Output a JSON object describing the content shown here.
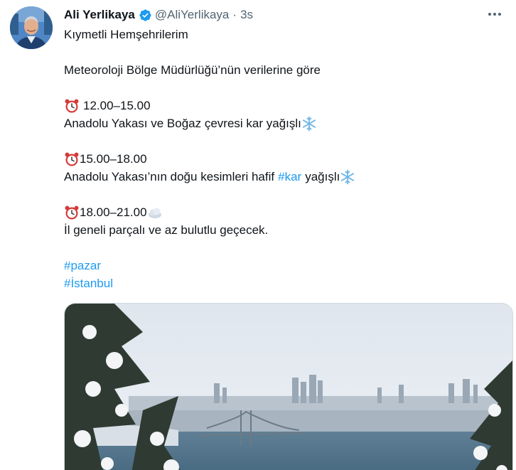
{
  "author": {
    "display_name": "Ali Yerlikaya",
    "handle": "@AliYerlikaya",
    "separator": "·",
    "time": "3s",
    "verified": true
  },
  "tweet": {
    "greeting": "Kıymetli Hemşehrilerim",
    "source": "Meteoroloji Bölge Müdürlüğü’nün verilerine göre",
    "block1": {
      "time": "12.00–15.00",
      "text": "Anadolu Yakası ve Boğaz çevresi kar yağışlı"
    },
    "block2": {
      "time": "15.00–18.00",
      "text_before": "Anadolu Yakası’nın doğu kesimleri hafif",
      "hashtag": "#kar",
      "text_after": "yağışlı"
    },
    "block3": {
      "time": "18.00–21.00",
      "text": "İl geneli parçalı ve az bulutlu geçecek."
    },
    "hashtags": [
      "#pazar",
      "#İstanbul"
    ]
  },
  "icons": {
    "verified": "verified-badge-icon",
    "more": "more-options-icon",
    "alarm": "alarm-clock-emoji",
    "snow": "snowflake-emoji",
    "cloud": "cloud-emoji"
  },
  "colors": {
    "link": "#1d9bf0",
    "secondary_text": "#536471",
    "primary_text": "#0f1419"
  }
}
